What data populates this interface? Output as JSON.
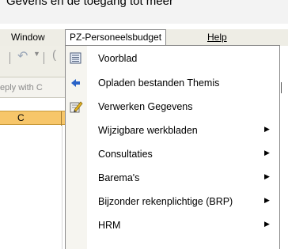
{
  "caption": "Gevens en de toegang tot meer",
  "menubar": {
    "window": "Window",
    "pz": "PZ-Personeelsbudget",
    "help": "Help"
  },
  "reply": "eply with C",
  "column": "C",
  "menu": {
    "items": [
      {
        "label": "Voorblad",
        "icon": "document-icon",
        "submenu": false
      },
      {
        "label": "Opladen bestanden Themis",
        "icon": "arrow-left-icon",
        "submenu": false
      },
      {
        "label": "Verwerken Gegevens",
        "icon": "edit-icon",
        "submenu": false
      },
      {
        "label": "Wijzigbare werkbladen",
        "icon": "",
        "submenu": true
      },
      {
        "label": "Consultaties",
        "icon": "",
        "submenu": true
      },
      {
        "label": "Barema's",
        "icon": "",
        "submenu": true
      },
      {
        "label": "Bijzonder rekenplichtige (BRP)",
        "icon": "",
        "submenu": true
      },
      {
        "label": "HRM",
        "icon": "",
        "submenu": true
      }
    ]
  },
  "colors": {
    "menubar_bg": "#eeede5",
    "column_header": "#f7c66a",
    "icon_blue": "#2a63c7"
  }
}
